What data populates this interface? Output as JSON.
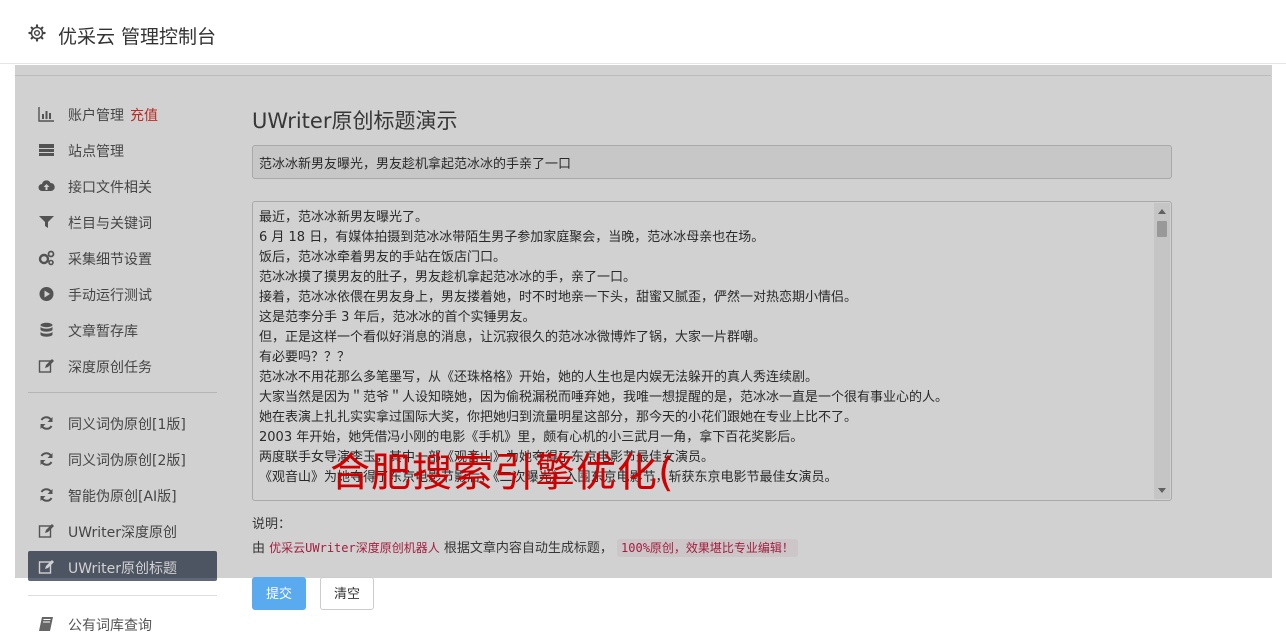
{
  "header": {
    "title": "优采云 管理控制台"
  },
  "sidebar": {
    "items": [
      {
        "label": "账户管理",
        "badge": "充值",
        "icon": "bar-chart-icon"
      },
      {
        "label": "站点管理",
        "icon": "server-icon"
      },
      {
        "label": "接口文件相关",
        "icon": "cloud-upload-icon"
      },
      {
        "label": "栏目与关键词",
        "icon": "filter-icon"
      },
      {
        "label": "采集细节设置",
        "icon": "gears-icon"
      },
      {
        "label": "手动运行测试",
        "icon": "play-circle-icon"
      },
      {
        "label": "文章暂存库",
        "icon": "database-icon"
      },
      {
        "label": "深度原创任务",
        "icon": "edit-icon"
      },
      {
        "label": "同义词伪原创[1版]",
        "icon": "refresh-icon"
      },
      {
        "label": "同义词伪原创[2版]",
        "icon": "refresh-icon"
      },
      {
        "label": "智能伪原创[AI版]",
        "icon": "refresh-icon"
      },
      {
        "label": "UWriter深度原创",
        "icon": "edit-icon"
      },
      {
        "label": "UWriter原创标题",
        "icon": "edit-icon"
      },
      {
        "label": "公有词库查询",
        "icon": "book-icon"
      }
    ],
    "active_index": 12
  },
  "main": {
    "title": "UWriter原创标题演示",
    "title_input_value": "范冰冰新男友曝光，男友趁机拿起范冰冰的手亲了一口",
    "article_lines": [
      "最近，范冰冰新男友曝光了。",
      "6 月 18 日，有媒体拍摄到范冰冰带陌生男子参加家庭聚会，当晚，范冰冰母亲也在场。",
      "饭后，范冰冰牵着男友的手站在饭店门口。",
      "范冰冰摸了摸男友的肚子，男友趁机拿起范冰冰的手，亲了一口。",
      "接着，范冰冰依偎在男友身上，男友搂着她，时不时地亲一下头，甜蜜又腻歪，俨然一对热恋期小情侣。",
      "这是范李分手 3 年后，范冰冰的首个实锤男友。",
      "但，正是这样一个看似好消息的消息，让沉寂很久的范冰冰微博炸了锅，大家一片群嘲。",
      "有必要吗？？？",
      "范冰冰不用花那么多笔墨写，从《还珠格格》开始，她的人生也是内娱无法躲开的真人秀连续剧。",
      "大家当然是因为＂范爷＂人设知晓她，因为偷税漏税而唾弃她，我唯一想提醒的是，范冰冰一直是一个很有事业心的人。",
      "她在表演上扎扎实实拿过国际大奖，你把她归到流量明星这部分，那今天的小花们跟她在专业上比不了。",
      "2003 年开始，她凭借冯小刚的电影《手机》里，颇有心机的小三武月一角，拿下百花奖影后。",
      "两度联手女导演李玉，其中一部《观音山》为她夺得了东京电影节最佳女演员。",
      "《观音山》为她夺得了东京电影节影后，《二次曝光》入围东京电影节，斩获东京电影节最佳女演员。"
    ],
    "watermark": "合肥搜索引擎优化(",
    "description_label": "说明：",
    "description": {
      "prefix": "由",
      "code1": "优采云UWriter深度原创机器人",
      "middle": "根据文章内容自动生成标题，",
      "code2": "100%原创，效果堪比专业编辑！"
    },
    "buttons": {
      "submit": "提交",
      "clear": "清空"
    }
  }
}
